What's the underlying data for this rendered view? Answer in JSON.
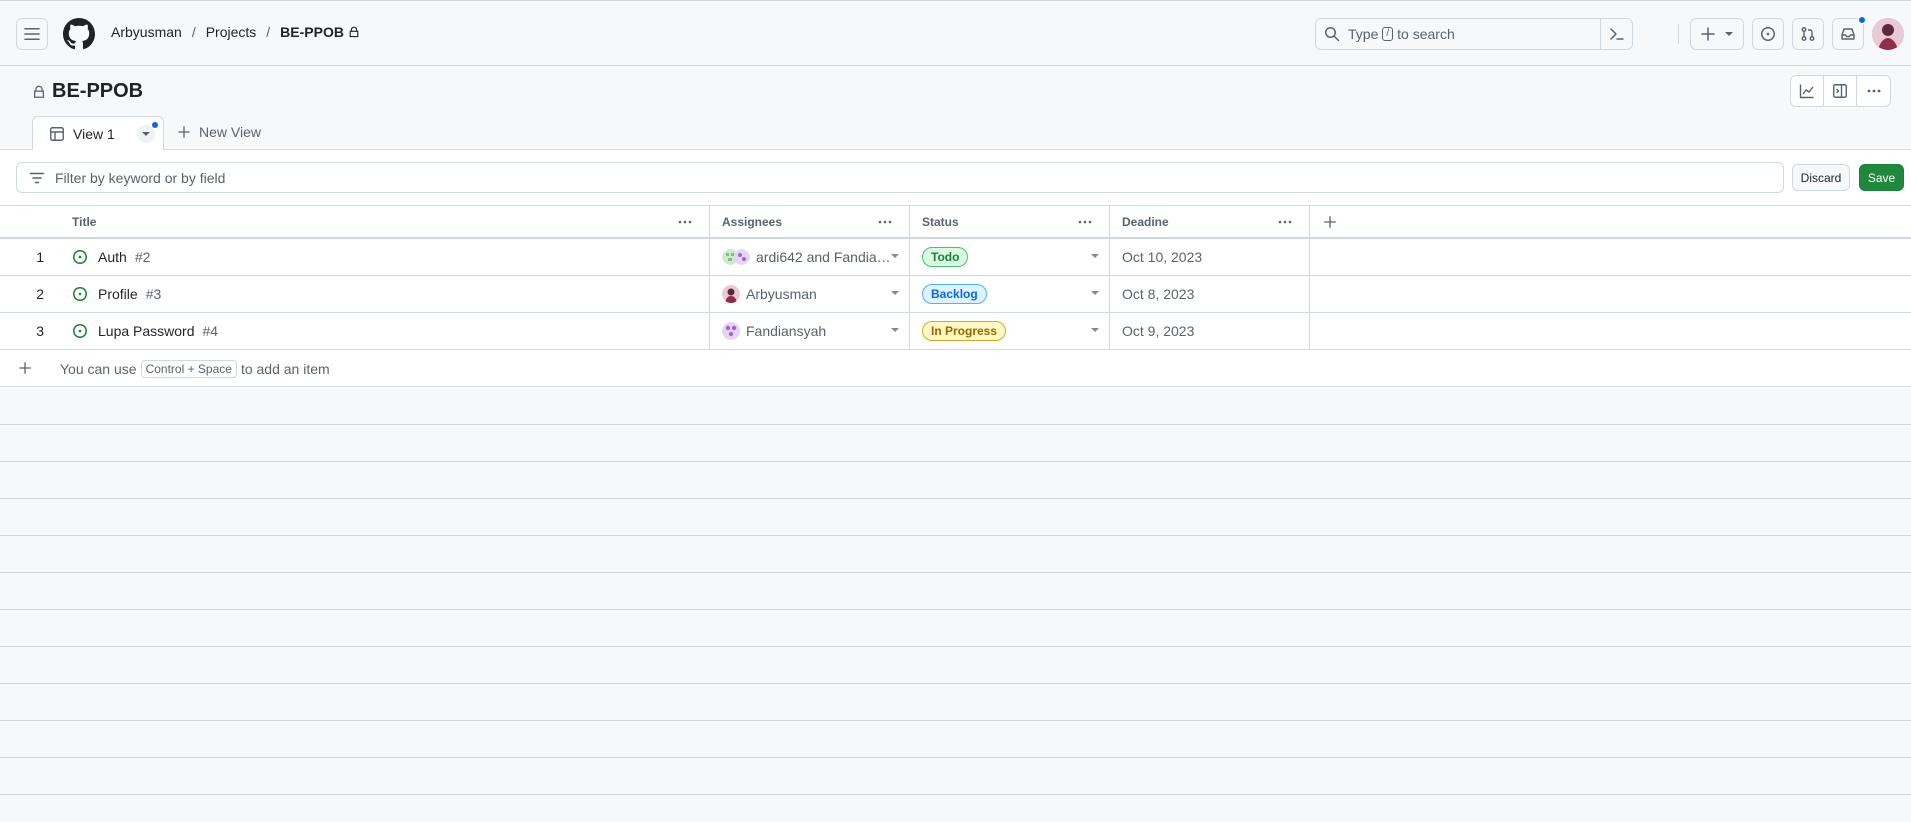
{
  "header": {
    "breadcrumb": [
      "Arbyusman",
      "Projects",
      "BE-PPOB"
    ],
    "search_prefix": "Type",
    "search_key": "/",
    "search_suffix": "to search"
  },
  "project": {
    "title": "BE-PPOB"
  },
  "tabs": {
    "active_label": "View 1",
    "new_view_label": "New View"
  },
  "filter": {
    "placeholder": "Filter by keyword or by field",
    "discard_label": "Discard",
    "save_label": "Save"
  },
  "table": {
    "columns": [
      "Title",
      "Assignees",
      "Status",
      "Deadine"
    ],
    "rows": [
      {
        "num": "1",
        "title": "Auth",
        "issue": "#2",
        "assignees": "ardi642 and Fandiansyah",
        "status": "Todo",
        "deadline": "Oct 10, 2023"
      },
      {
        "num": "2",
        "title": "Profile",
        "issue": "#3",
        "assignees": "Arbyusman",
        "status": "Backlog",
        "deadline": "Oct 8, 2023"
      },
      {
        "num": "3",
        "title": "Lupa Password",
        "issue": "#4",
        "assignees": "Fandiansyah",
        "status": "In Progress",
        "deadline": "Oct 9, 2023"
      }
    ],
    "add_hint_prefix": "You can use",
    "add_hint_key": "Control + Space",
    "add_hint_suffix": "to add an item"
  },
  "colors": {
    "todo": "#1a7f37",
    "backlog": "#0969da",
    "in_progress": "#9a6700",
    "save": "#1f883d"
  }
}
